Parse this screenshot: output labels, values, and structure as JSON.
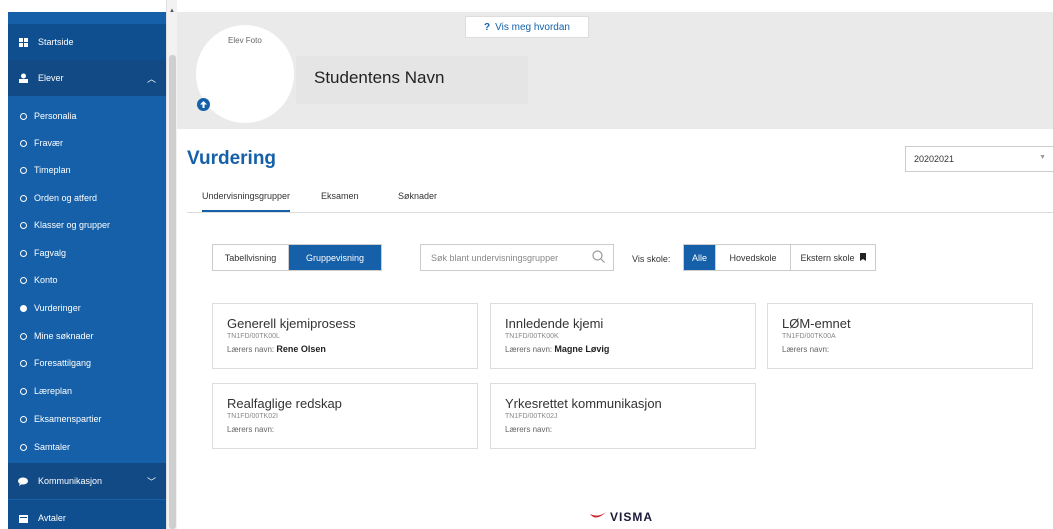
{
  "sidebar": {
    "items": [
      {
        "label": "Startside",
        "type": "main",
        "icon": "grid-icon"
      },
      {
        "label": "Elever",
        "type": "main",
        "icon": "person-icon",
        "expanded": true
      },
      {
        "label": "Personalia",
        "type": "sub"
      },
      {
        "label": "Fravær",
        "type": "sub"
      },
      {
        "label": "Timeplan",
        "type": "sub"
      },
      {
        "label": "Orden og atferd",
        "type": "sub"
      },
      {
        "label": "Klasser og grupper",
        "type": "sub"
      },
      {
        "label": "Fagvalg",
        "type": "sub"
      },
      {
        "label": "Konto",
        "type": "sub"
      },
      {
        "label": "Vurderinger",
        "type": "sub",
        "active": true
      },
      {
        "label": "Mine søknader",
        "type": "sub"
      },
      {
        "label": "Foresattilgang",
        "type": "sub"
      },
      {
        "label": "Læreplan",
        "type": "sub"
      },
      {
        "label": "Eksamenspartier",
        "type": "sub"
      },
      {
        "label": "Samtaler",
        "type": "sub"
      },
      {
        "label": "Kommunikasjon",
        "type": "main",
        "icon": "chat-icon"
      },
      {
        "label": "Avtaler",
        "type": "main",
        "icon": "calendar-icon"
      }
    ]
  },
  "header": {
    "photo_label": "Elev Foto",
    "student_name": "Studentens Navn",
    "help_button": "Vis meg hvordan"
  },
  "main": {
    "title": "Vurdering",
    "year": "20202021",
    "tabs": [
      "Undervisningsgrupper",
      "Eksamen",
      "Søknader"
    ],
    "view_buttons": [
      "Tabellvisning",
      "Gruppevisning"
    ],
    "search_placeholder": "Søk blant undervisningsgrupper",
    "vis_skole_label": "Vis skole:",
    "school_buttons": [
      "Alle",
      "Hovedskole",
      "Ekstern skole"
    ]
  },
  "cards": [
    {
      "title": "Generell kjemiprosess",
      "code": "TN1FD/00TK00L",
      "teacher_label": "Lærers navn:",
      "teacher": "Rene Olsen"
    },
    {
      "title": "Innledende kjemi",
      "code": "TN1FD/00TK00K",
      "teacher_label": "Lærers navn:",
      "teacher": "Magne Løvig"
    },
    {
      "title": "LØM-emnet",
      "code": "TN1FD/00TK00A",
      "teacher_label": "Lærers navn:",
      "teacher": ""
    },
    {
      "title": "Realfaglige redskap",
      "code": "TN1FD/00TK02I",
      "teacher_label": "Lærers navn:",
      "teacher": ""
    },
    {
      "title": "Yrkesrettet kommunikasjon",
      "code": "TN1FD/00TK02J",
      "teacher_label": "Lærers navn:",
      "teacher": ""
    }
  ],
  "footer": {
    "logo_text": "VISMA"
  },
  "colors": {
    "primary": "#1560a8",
    "sidebar": "#1560a8",
    "header_bg": "#eaeaea"
  }
}
